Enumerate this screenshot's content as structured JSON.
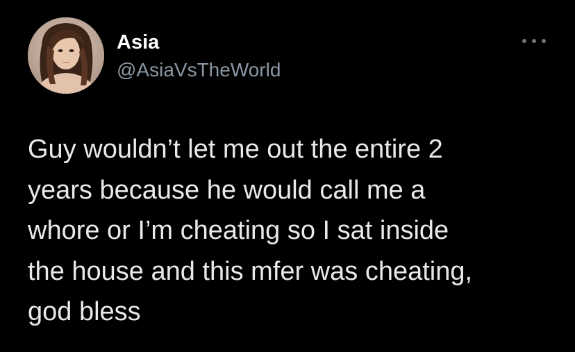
{
  "author": {
    "display_name": "Asia",
    "handle": "@AsiaVsTheWorld",
    "avatar_icon": "profile-photo"
  },
  "tweet": {
    "text": "Guy wouldn’t let me out the entire 2\nyears because he would call me a\nwhore or I’m cheating so I sat inside\nthe house and this mfer was cheating,\ngod bless"
  },
  "controls": {
    "more_icon": "more-options-icon"
  },
  "colors": {
    "background": "#000000",
    "name": "#ffffff",
    "handle": "#8b98a5",
    "text": "#e7e9ea",
    "more_dots": "#6e767d"
  }
}
